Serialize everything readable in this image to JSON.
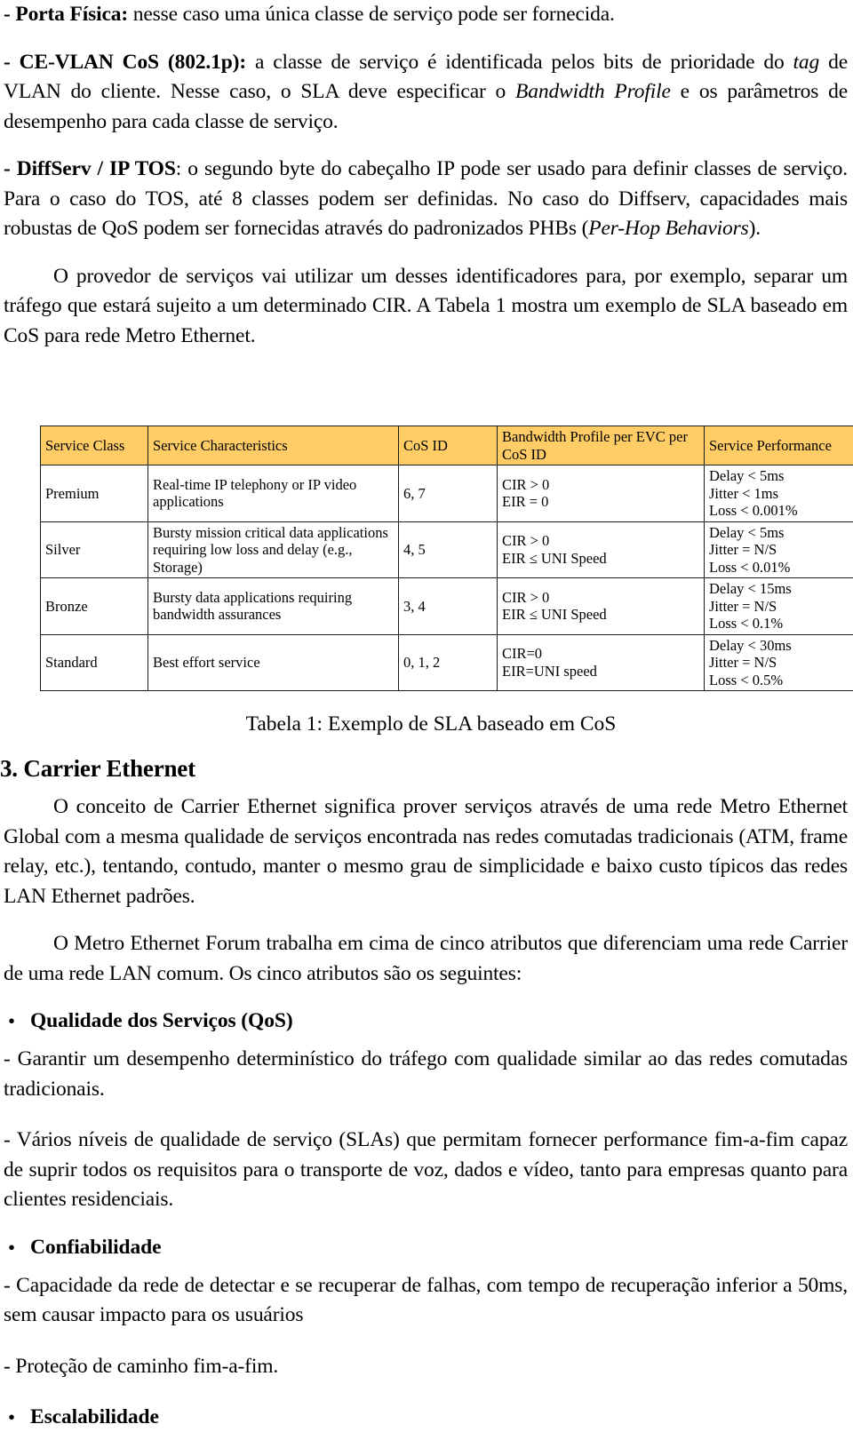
{
  "document": {
    "paragraphs": {
      "p_porta_fisica_label": "- Porta Física:",
      "p_porta_fisica_text": " nesse caso uma única classe de serviço pode ser fornecida.",
      "p_cevlan_label": "- CE-VLAN CoS (802.1p):",
      "p_cevlan_text_1": " a classe de serviço é identificada pelos bits de prioridade do ",
      "p_cevlan_italic_1": "tag",
      "p_cevlan_text_2": " de VLAN do cliente. Nesse caso, o SLA deve especificar o ",
      "p_cevlan_italic_2": "Bandwidth Profile",
      "p_cevlan_text_3": " e os parâmetros de desempenho para cada classe de serviço.",
      "p_diffserv_label": "- DiffServ / IP TOS",
      "p_diffserv_text_1": ": o segundo byte do cabeçalho IP pode ser usado para definir classes de serviço. Para o caso do TOS, até 8 classes podem ser definidas. No caso do Diffserv, capacidades mais robustas de QoS podem ser fornecidas através do padronizados PHBs (",
      "p_diffserv_italic_1": "Per-Hop Behaviors",
      "p_diffserv_text_2": ").",
      "p_provedor": "O provedor de serviços vai utilizar um desses identificadores para, por exemplo, separar um tráfego que estará sujeito a um determinado CIR. A Tabela 1 mostra um exemplo de SLA baseado em CoS para rede Metro Ethernet.",
      "p_conceito": "O conceito de Carrier Ethernet significa prover serviços através de uma rede Metro Ethernet Global com a mesma qualidade de serviços encontrada nas redes comutadas tradicionais (ATM, frame relay, etc.), tentando, contudo, manter o mesmo grau de simplicidade e baixo custo típicos das redes LAN Ethernet padrões.",
      "p_mef": "O Metro Ethernet Forum trabalha em cima de cinco atributos que diferenciam uma rede Carrier de uma rede LAN comum. Os cinco atributos são os seguintes:",
      "p_qos_dash_1": "- Garantir um desempenho determinístico do tráfego com qualidade similar ao das redes comutadas tradicionais.",
      "p_qos_dash_2": "- Vários níveis de qualidade de serviço (SLAs) que permitam fornecer performance fim-a-fim capaz de suprir todos os requisitos para o transporte de voz, dados e vídeo, tanto para empresas quanto para clientes residenciais.",
      "p_conf_dash_1": "- Capacidade da rede de detectar e se recuperar de falhas, com  tempo de recuperação inferior a 50ms, sem causar impacto para os usuários",
      "p_conf_dash_2": "- Proteção de caminho fim-a-fim."
    },
    "table": {
      "header_bg_color": "#ffcc66",
      "columns": [
        "Service Class",
        "Service Characteristics",
        "CoS ID",
        "Bandwidth Profile per EVC per CoS ID",
        "Service Performance"
      ],
      "rows": [
        {
          "service_class": "Premium",
          "service_characteristics": "Real-time IP telephony or IP video applications",
          "cos_id": "6, 7",
          "bandwidth_profile": [
            "CIR > 0",
            "EIR = 0"
          ],
          "service_performance": [
            "Delay < 5ms",
            "Jitter < 1ms",
            "Loss < 0.001%"
          ]
        },
        {
          "service_class": "Silver",
          "service_characteristics": "Bursty mission critical data applications requiring low loss and delay (e.g., Storage)",
          "cos_id": "4, 5",
          "bandwidth_profile": [
            "CIR > 0",
            "EIR ≤ UNI Speed"
          ],
          "service_performance": [
            "Delay < 5ms",
            "Jitter = N/S",
            "Loss < 0.01%"
          ]
        },
        {
          "service_class": "Bronze",
          "service_characteristics": "Bursty data applications requiring bandwidth assurances",
          "cos_id": "3, 4",
          "bandwidth_profile": [
            "CIR > 0",
            "EIR ≤ UNI Speed"
          ],
          "service_performance": [
            "Delay < 15ms",
            "Jitter = N/S",
            "Loss < 0.1%"
          ]
        },
        {
          "service_class": "Standard",
          "service_characteristics": "Best effort service",
          "cos_id": "0, 1, 2",
          "bandwidth_profile": [
            "CIR=0",
            "EIR=UNI speed"
          ],
          "service_performance": [
            "Delay < 30ms",
            "Jitter = N/S",
            "Loss < 0.5%"
          ]
        }
      ],
      "caption": "Tabela 1: Exemplo de SLA baseado em CoS"
    },
    "section": {
      "heading": "3. Carrier Ethernet"
    },
    "bullets": {
      "dot_glyph": "•",
      "items": [
        {
          "label": "Qualidade dos Serviços (QoS)"
        },
        {
          "label": "Confiabilidade"
        },
        {
          "label": "Escalabilidade"
        }
      ]
    }
  }
}
